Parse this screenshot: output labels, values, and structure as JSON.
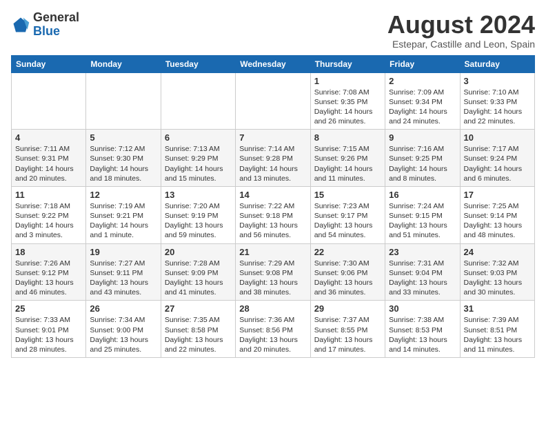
{
  "header": {
    "logo_general": "General",
    "logo_blue": "Blue",
    "month_year": "August 2024",
    "location": "Estepar, Castille and Leon, Spain"
  },
  "weekdays": [
    "Sunday",
    "Monday",
    "Tuesday",
    "Wednesday",
    "Thursday",
    "Friday",
    "Saturday"
  ],
  "weeks": [
    [
      {
        "day": "",
        "info": ""
      },
      {
        "day": "",
        "info": ""
      },
      {
        "day": "",
        "info": ""
      },
      {
        "day": "",
        "info": ""
      },
      {
        "day": "1",
        "info": "Sunrise: 7:08 AM\nSunset: 9:35 PM\nDaylight: 14 hours and 26 minutes."
      },
      {
        "day": "2",
        "info": "Sunrise: 7:09 AM\nSunset: 9:34 PM\nDaylight: 14 hours and 24 minutes."
      },
      {
        "day": "3",
        "info": "Sunrise: 7:10 AM\nSunset: 9:33 PM\nDaylight: 14 hours and 22 minutes."
      }
    ],
    [
      {
        "day": "4",
        "info": "Sunrise: 7:11 AM\nSunset: 9:31 PM\nDaylight: 14 hours and 20 minutes."
      },
      {
        "day": "5",
        "info": "Sunrise: 7:12 AM\nSunset: 9:30 PM\nDaylight: 14 hours and 18 minutes."
      },
      {
        "day": "6",
        "info": "Sunrise: 7:13 AM\nSunset: 9:29 PM\nDaylight: 14 hours and 15 minutes."
      },
      {
        "day": "7",
        "info": "Sunrise: 7:14 AM\nSunset: 9:28 PM\nDaylight: 14 hours and 13 minutes."
      },
      {
        "day": "8",
        "info": "Sunrise: 7:15 AM\nSunset: 9:26 PM\nDaylight: 14 hours and 11 minutes."
      },
      {
        "day": "9",
        "info": "Sunrise: 7:16 AM\nSunset: 9:25 PM\nDaylight: 14 hours and 8 minutes."
      },
      {
        "day": "10",
        "info": "Sunrise: 7:17 AM\nSunset: 9:24 PM\nDaylight: 14 hours and 6 minutes."
      }
    ],
    [
      {
        "day": "11",
        "info": "Sunrise: 7:18 AM\nSunset: 9:22 PM\nDaylight: 14 hours and 3 minutes."
      },
      {
        "day": "12",
        "info": "Sunrise: 7:19 AM\nSunset: 9:21 PM\nDaylight: 14 hours and 1 minute."
      },
      {
        "day": "13",
        "info": "Sunrise: 7:20 AM\nSunset: 9:19 PM\nDaylight: 13 hours and 59 minutes."
      },
      {
        "day": "14",
        "info": "Sunrise: 7:22 AM\nSunset: 9:18 PM\nDaylight: 13 hours and 56 minutes."
      },
      {
        "day": "15",
        "info": "Sunrise: 7:23 AM\nSunset: 9:17 PM\nDaylight: 13 hours and 54 minutes."
      },
      {
        "day": "16",
        "info": "Sunrise: 7:24 AM\nSunset: 9:15 PM\nDaylight: 13 hours and 51 minutes."
      },
      {
        "day": "17",
        "info": "Sunrise: 7:25 AM\nSunset: 9:14 PM\nDaylight: 13 hours and 48 minutes."
      }
    ],
    [
      {
        "day": "18",
        "info": "Sunrise: 7:26 AM\nSunset: 9:12 PM\nDaylight: 13 hours and 46 minutes."
      },
      {
        "day": "19",
        "info": "Sunrise: 7:27 AM\nSunset: 9:11 PM\nDaylight: 13 hours and 43 minutes."
      },
      {
        "day": "20",
        "info": "Sunrise: 7:28 AM\nSunset: 9:09 PM\nDaylight: 13 hours and 41 minutes."
      },
      {
        "day": "21",
        "info": "Sunrise: 7:29 AM\nSunset: 9:08 PM\nDaylight: 13 hours and 38 minutes."
      },
      {
        "day": "22",
        "info": "Sunrise: 7:30 AM\nSunset: 9:06 PM\nDaylight: 13 hours and 36 minutes."
      },
      {
        "day": "23",
        "info": "Sunrise: 7:31 AM\nSunset: 9:04 PM\nDaylight: 13 hours and 33 minutes."
      },
      {
        "day": "24",
        "info": "Sunrise: 7:32 AM\nSunset: 9:03 PM\nDaylight: 13 hours and 30 minutes."
      }
    ],
    [
      {
        "day": "25",
        "info": "Sunrise: 7:33 AM\nSunset: 9:01 PM\nDaylight: 13 hours and 28 minutes."
      },
      {
        "day": "26",
        "info": "Sunrise: 7:34 AM\nSunset: 9:00 PM\nDaylight: 13 hours and 25 minutes."
      },
      {
        "day": "27",
        "info": "Sunrise: 7:35 AM\nSunset: 8:58 PM\nDaylight: 13 hours and 22 minutes."
      },
      {
        "day": "28",
        "info": "Sunrise: 7:36 AM\nSunset: 8:56 PM\nDaylight: 13 hours and 20 minutes."
      },
      {
        "day": "29",
        "info": "Sunrise: 7:37 AM\nSunset: 8:55 PM\nDaylight: 13 hours and 17 minutes."
      },
      {
        "day": "30",
        "info": "Sunrise: 7:38 AM\nSunset: 8:53 PM\nDaylight: 13 hours and 14 minutes."
      },
      {
        "day": "31",
        "info": "Sunrise: 7:39 AM\nSunset: 8:51 PM\nDaylight: 13 hours and 11 minutes."
      }
    ]
  ]
}
